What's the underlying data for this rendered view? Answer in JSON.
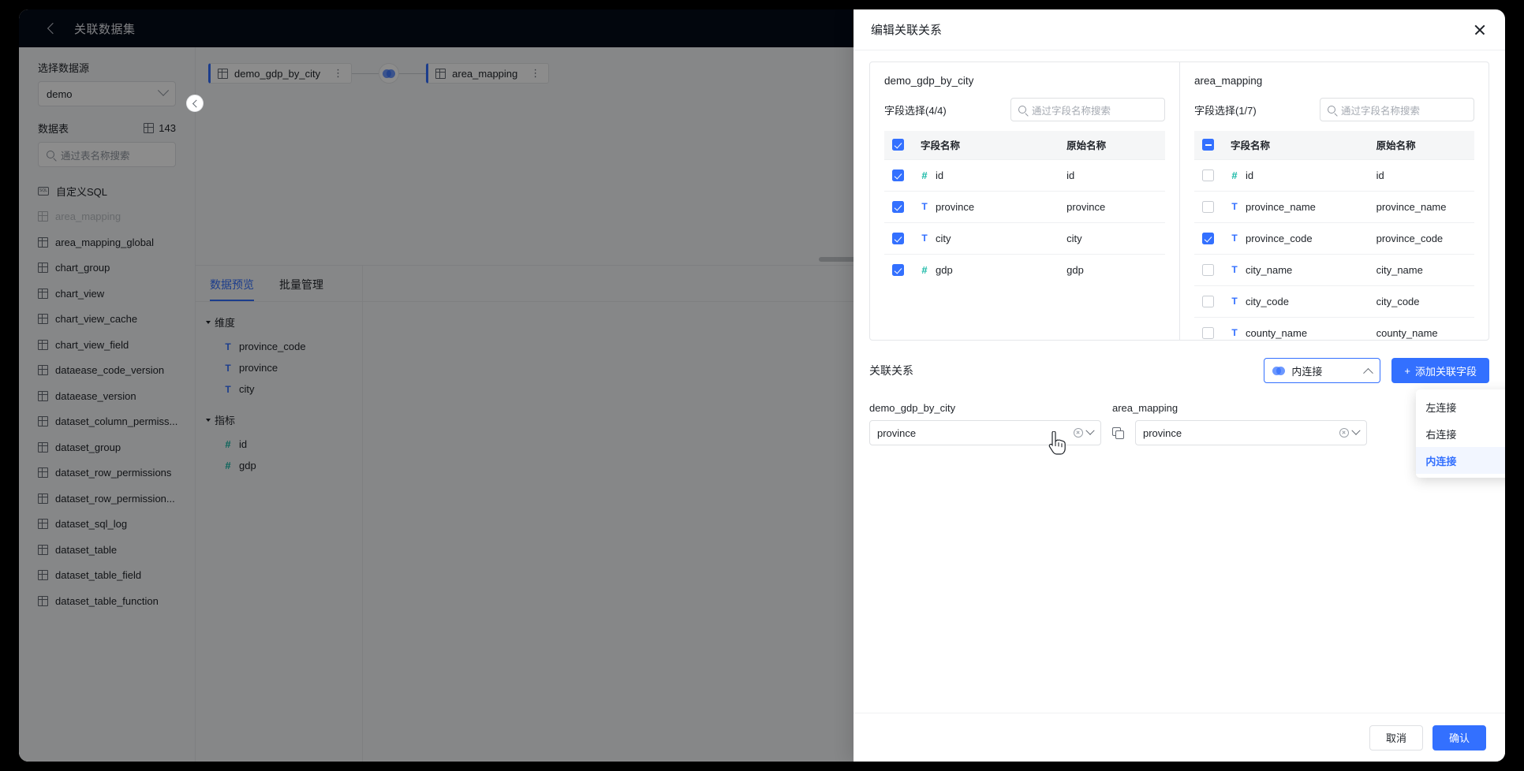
{
  "topbar": {
    "title": "关联数据集",
    "back_icon": "chevron-left-icon"
  },
  "sidebar": {
    "datasource_label": "选择数据源",
    "datasource_value": "demo",
    "tables_label": "数据表",
    "tables_count": "143",
    "search_placeholder": "通过表名称搜索",
    "custom_sql": "自定义SQL",
    "tables": [
      {
        "name": "area_mapping",
        "dim": true
      },
      {
        "name": "area_mapping_global",
        "dim": false
      },
      {
        "name": "chart_group",
        "dim": false
      },
      {
        "name": "chart_view",
        "dim": false
      },
      {
        "name": "chart_view_cache",
        "dim": false
      },
      {
        "name": "chart_view_field",
        "dim": false
      },
      {
        "name": "dataease_code_version",
        "dim": false
      },
      {
        "name": "dataease_version",
        "dim": false
      },
      {
        "name": "dataset_column_permiss...",
        "dim": false
      },
      {
        "name": "dataset_group",
        "dim": false
      },
      {
        "name": "dataset_row_permissions",
        "dim": false
      },
      {
        "name": "dataset_row_permission...",
        "dim": false
      },
      {
        "name": "dataset_sql_log",
        "dim": false
      },
      {
        "name": "dataset_table",
        "dim": false
      },
      {
        "name": "dataset_table_field",
        "dim": false
      },
      {
        "name": "dataset_table_function",
        "dim": false
      }
    ]
  },
  "canvas": {
    "left_node": "demo_gdp_by_city",
    "right_node": "area_mapping",
    "join_icon": "venn-inner-join-icon"
  },
  "lower": {
    "tabs": [
      {
        "label": "数据预览",
        "active": true
      },
      {
        "label": "批量管理",
        "active": false
      }
    ],
    "groups": [
      {
        "title": "维度",
        "fields": [
          {
            "name": "province_code",
            "type": "T"
          },
          {
            "name": "province",
            "type": "T"
          },
          {
            "name": "city",
            "type": "T"
          }
        ]
      },
      {
        "title": "指标",
        "fields": [
          {
            "name": "id",
            "type": "#"
          },
          {
            "name": "gdp",
            "type": "#"
          }
        ]
      }
    ]
  },
  "dialog": {
    "title": "编辑关联关系",
    "close_icon": "close-icon",
    "left_pane": {
      "table_name": "demo_gdp_by_city",
      "select_label": "字段选择(4/4)",
      "search_placeholder": "通过字段名称搜索",
      "header_checkbox_state": "checked",
      "columns": [
        "字段名称",
        "原始名称"
      ],
      "rows": [
        {
          "checked": true,
          "type": "#",
          "name": "id",
          "origin": "id"
        },
        {
          "checked": true,
          "type": "T",
          "name": "province",
          "origin": "province"
        },
        {
          "checked": true,
          "type": "T",
          "name": "city",
          "origin": "city"
        },
        {
          "checked": true,
          "type": "#",
          "name": "gdp",
          "origin": "gdp"
        }
      ]
    },
    "right_pane": {
      "table_name": "area_mapping",
      "select_label": "字段选择(1/7)",
      "search_placeholder": "通过字段名称搜索",
      "header_checkbox_state": "indeterminate",
      "columns": [
        "字段名称",
        "原始名称"
      ],
      "rows": [
        {
          "checked": false,
          "type": "#",
          "name": "id",
          "origin": "id"
        },
        {
          "checked": false,
          "type": "T",
          "name": "province_name",
          "origin": "province_name"
        },
        {
          "checked": true,
          "type": "T",
          "name": "province_code",
          "origin": "province_code"
        },
        {
          "checked": false,
          "type": "T",
          "name": "city_name",
          "origin": "city_name"
        },
        {
          "checked": false,
          "type": "T",
          "name": "city_code",
          "origin": "city_code"
        },
        {
          "checked": false,
          "type": "T",
          "name": "county_name",
          "origin": "county_name"
        }
      ]
    },
    "relation": {
      "title": "关联关系",
      "join_type_value": "内连接",
      "join_type_icon": "venn-inner-join-icon",
      "add_field_label": "添加关联字段",
      "dropdown_options": [
        {
          "label": "左连接",
          "selected": false
        },
        {
          "label": "右连接",
          "selected": false
        },
        {
          "label": "内连接",
          "selected": true
        }
      ],
      "left_table_label": "demo_gdp_by_city",
      "right_table_label": "area_mapping",
      "left_field_value": "province",
      "right_field_value": "province",
      "swap_icon": "copy-icon"
    },
    "footer": {
      "cancel_label": "取消",
      "confirm_label": "确认"
    }
  },
  "colors": {
    "accent": "#3370ff",
    "text": "#1f2329",
    "muted": "#8f959e",
    "metric": "#17b8a6",
    "topbar_bg": "#050b18"
  }
}
